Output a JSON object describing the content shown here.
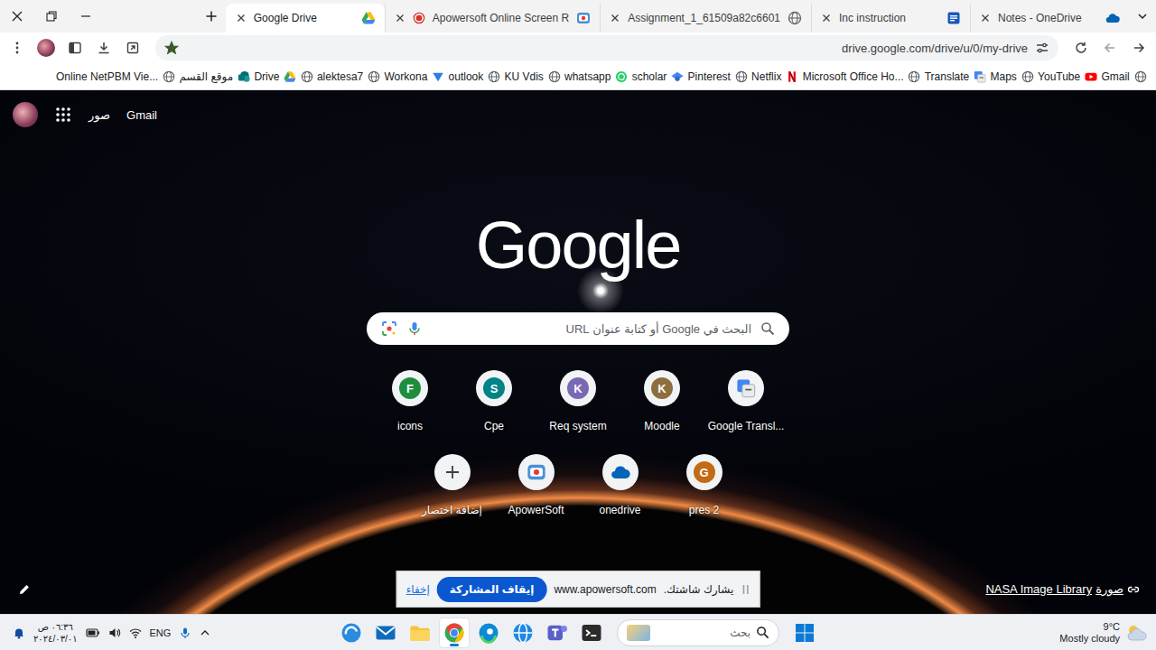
{
  "tabs": [
    {
      "title": "Google Drive",
      "selected": true,
      "recording": false,
      "kind": "drive"
    },
    {
      "title": "Apowersoft Online Screen R",
      "selected": false,
      "recording": true,
      "kind": "apowersoft"
    },
    {
      "title": "Assignment_1_61509a82c6601",
      "selected": false,
      "recording": false,
      "kind": "globe"
    },
    {
      "title": "Inc instruction",
      "selected": false,
      "recording": false,
      "kind": "word"
    },
    {
      "title": "Notes - OneDrive",
      "selected": false,
      "recording": false,
      "kind": "onedrive"
    }
  ],
  "address": {
    "url": "drive.google.com/drive/u/0/my-drive",
    "bookmarked": true
  },
  "bookmarks": [
    {
      "label": "Online NetPBM Vie...",
      "kind": "globe"
    },
    {
      "label": "موقع القسم",
      "kind": "sharepoint"
    },
    {
      "label": "Drive",
      "kind": "drive"
    },
    {
      "label": "",
      "kind": "globe"
    },
    {
      "label": "alektesa7",
      "kind": "globe"
    },
    {
      "label": "Workona",
      "kind": "workona"
    },
    {
      "label": "outlook",
      "kind": "globe"
    },
    {
      "label": "KU Vdis",
      "kind": "globe"
    },
    {
      "label": "whatsapp",
      "kind": "whatsapp"
    },
    {
      "label": "scholar",
      "kind": "scholar"
    },
    {
      "label": "Pinterest",
      "kind": "globe"
    },
    {
      "label": "Netflix",
      "kind": "netflix"
    },
    {
      "label": "Microsoft Office Ho...",
      "kind": "globe"
    },
    {
      "label": "Translate",
      "kind": "translate"
    },
    {
      "label": "Maps",
      "kind": "globe"
    },
    {
      "label": "YouTube",
      "kind": "youtube"
    },
    {
      "label": "Gmail",
      "kind": "globe"
    }
  ],
  "newtab": {
    "header_links": [
      "صور",
      "Gmail"
    ],
    "logo": "Google",
    "search": {
      "placeholder": "البحث في Google أو كتابة عنوان URL"
    },
    "shortcuts": [
      {
        "label": "icons",
        "kind": "letter",
        "letter": "F",
        "color": "#1e8e3e"
      },
      {
        "label": "Cpe",
        "kind": "letter",
        "letter": "S",
        "color": "#038387"
      },
      {
        "label": "Req system",
        "kind": "letter",
        "letter": "K",
        "color": "#7b68b5"
      },
      {
        "label": "Moodle",
        "kind": "letter",
        "letter": "K",
        "color": "#8d6e3f"
      },
      {
        "label": "Google Transl...",
        "kind": "icon",
        "icon": "translate",
        "color": "#4285f4"
      },
      {
        "label": "إضافة اختصار",
        "kind": "add",
        "color": "#3c4043"
      },
      {
        "label": "ApowerSoft",
        "kind": "icon",
        "icon": "apowersoft",
        "color": "#4a90d9"
      },
      {
        "label": "onedrive",
        "kind": "icon",
        "icon": "onedrive",
        "color": "#0364b8"
      },
      {
        "label": "pres 2",
        "kind": "letter",
        "letter": "G",
        "color": "#c26a15"
      }
    ],
    "credit_source": "NASA Image Library",
    "credit_prefix": "صورة"
  },
  "share_banner": {
    "hide": "إخفاء",
    "stop": "إيقاف المشاركة",
    "source": "www.apowersoft.com",
    "message": "يشارك شاشتك."
  },
  "taskbar": {
    "clock": {
      "time": "٠٦:٣٦ ص",
      "date": "٢٠٢٤/٠٣/٠١"
    },
    "language": "ENG",
    "apps": [
      {
        "kind": "swirl",
        "active": false
      },
      {
        "kind": "mail",
        "active": false
      },
      {
        "kind": "folder",
        "active": false
      },
      {
        "kind": "chrome",
        "active": true
      },
      {
        "kind": "edge",
        "active": false
      },
      {
        "kind": "vpn",
        "active": false
      },
      {
        "kind": "teams",
        "active": false
      },
      {
        "kind": "terminal",
        "active": false
      }
    ],
    "search": "بحث",
    "weather": {
      "temp": "9°C",
      "condition": "Mostly cloudy"
    }
  }
}
